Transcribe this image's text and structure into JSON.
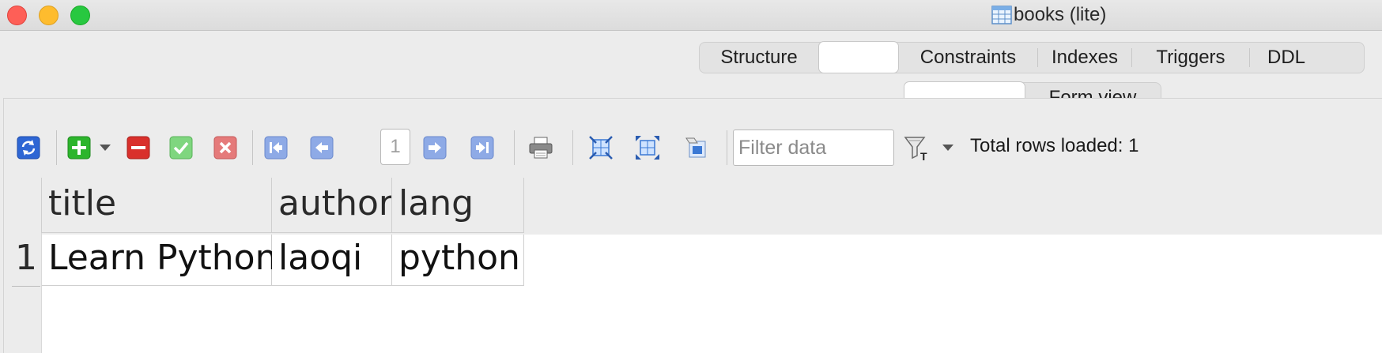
{
  "window": {
    "title": "books (lite)"
  },
  "tabs": [
    {
      "label": "Structure"
    },
    {
      "label": ""
    },
    {
      "label": "Constraints"
    },
    {
      "label": "Indexes"
    },
    {
      "label": "Triggers"
    },
    {
      "label": "DDL"
    }
  ],
  "subtabs": [
    {
      "label": ""
    },
    {
      "label": "Form view"
    }
  ],
  "toolbar": {
    "page_number": "1",
    "filter_placeholder": "Filter data",
    "rows_loaded": "Total rows loaded: 1"
  },
  "icons": {
    "refresh": "refresh-icon",
    "add_row": "add-row-icon",
    "delete_row": "delete-row-icon",
    "commit": "commit-icon",
    "rollback": "rollback-icon",
    "first_page": "first-page-icon",
    "prev_page": "prev-page-icon",
    "next_page": "next-page-icon",
    "last_page": "last-page-icon",
    "print": "print-icon",
    "filter": "filter-icon"
  },
  "colors": {
    "add_green": "#2db52d",
    "delete_red": "#d9302c",
    "commit_green": "#5fcf5f",
    "rollback_red": "#e06565",
    "nav_blue": "#7f9ce0",
    "refresh_blue": "#2e66d4"
  },
  "grid": {
    "columns": [
      "title",
      "author",
      "lang"
    ],
    "rows": [
      {
        "num": "1",
        "cells": [
          "Learn Python",
          "laoqi",
          "python"
        ]
      }
    ]
  }
}
